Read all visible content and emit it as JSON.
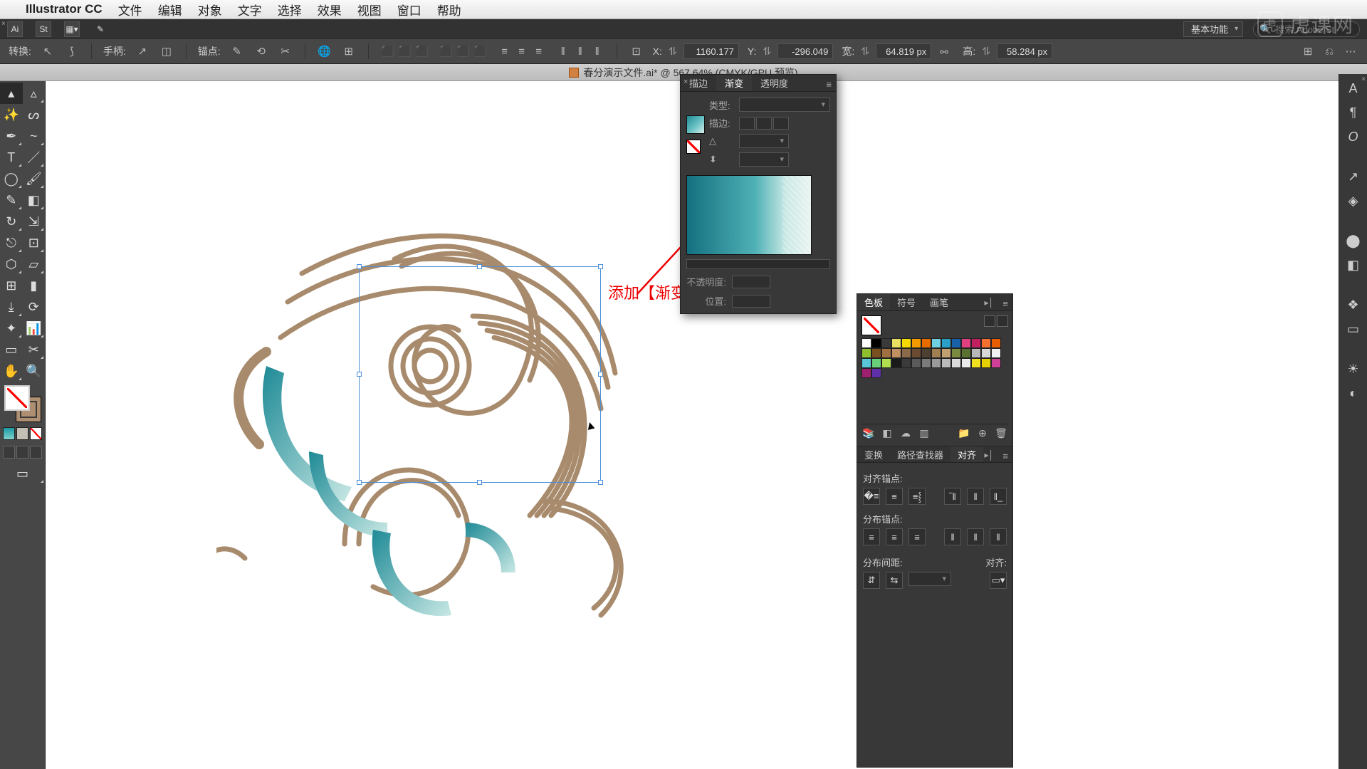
{
  "menubar": {
    "app": "Illustrator CC",
    "items": [
      "文件",
      "编辑",
      "对象",
      "文字",
      "选择",
      "效果",
      "视图",
      "窗口",
      "帮助"
    ]
  },
  "topbar1": {
    "st": "St",
    "preset": "基本功能",
    "search_placeholder": "搜索 Adobe St"
  },
  "topbar2": {
    "transform_label": "转换:",
    "handle_label": "手柄:",
    "anchor_label": "锚点:",
    "x_label": "X:",
    "x_val": "1160.177",
    "y_label": "Y:",
    "y_val": "-296.049",
    "w_label": "宽:",
    "w_val": "64.819 px",
    "h_label": "高:",
    "h_val": "58.284 px"
  },
  "doc": {
    "title": "春分演示文件.ai* @ 567.64% (CMYK/GPU 预览)"
  },
  "gradient_panel": {
    "tabs": [
      "描边",
      "渐变",
      "透明度"
    ],
    "type_label": "类型:",
    "stroke_label": "描边:",
    "opacity_label": "不透明度:",
    "location_label": "位置:"
  },
  "annotation": "添加【渐变】效果",
  "swatch_panel": {
    "tabs": [
      "色板",
      "符号",
      "画笔"
    ]
  },
  "align_panel": {
    "tabs": [
      "变换",
      "路径查找器",
      "对齐"
    ],
    "sec1": "对齐锚点:",
    "sec2": "分布锚点:",
    "sec3": "分布间距:",
    "sec3r": "对齐:"
  },
  "swatch_colors": [
    "#ffffff",
    "#000000",
    "#3a3a3a",
    "#e8e060",
    "#f4d900",
    "#f49b00",
    "#e86c00",
    "#6ed0e0",
    "#2aa0c8",
    "#1860a8",
    "#e04080",
    "#c02060",
    "#f47030",
    "#e85c00",
    "#90c030",
    "#7a5020",
    "#a07040",
    "#c09060",
    "#8a6a48",
    "#6a4a30",
    "#4d4030",
    "#a08050",
    "#c0a070",
    "#7a8a40",
    "#5a7030",
    "#b8b8b8",
    "#d8d8d8",
    "#f0f0f0",
    "#58c8d8",
    "#68d078",
    "#b0e050",
    "#1a1a1a",
    "#3a3a3a",
    "#5a5a5a",
    "#7a7a7a",
    "#9a9a9a",
    "#bababa",
    "#dadada",
    "#eaeaea",
    "#f0e020",
    "#e6d000",
    "#d04098",
    "#a02070",
    "#6030a8"
  ],
  "watermark": "虎课网"
}
